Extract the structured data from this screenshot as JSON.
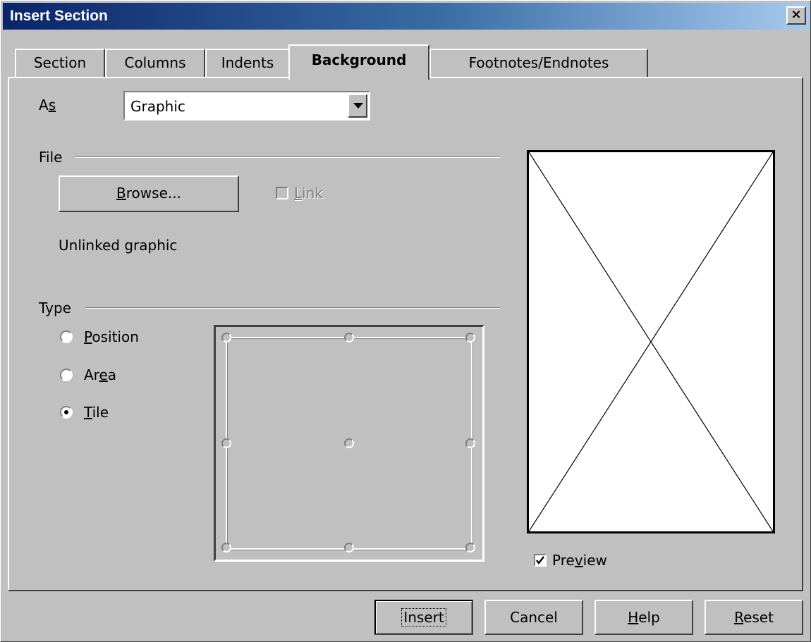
{
  "window": {
    "title": "Insert Section",
    "close_glyph": "×"
  },
  "tabs": [
    {
      "label": "Section"
    },
    {
      "label": "Columns"
    },
    {
      "label": "Indents"
    },
    {
      "label": "Background",
      "active": true
    },
    {
      "label": "Footnotes/Endnotes"
    }
  ],
  "as": {
    "label_prefix": "A",
    "label_mnemonic": "s",
    "value": "Graphic"
  },
  "file": {
    "group_label": "File",
    "browse_prefix": "",
    "browse_mnemonic": "B",
    "browse_suffix": "rowse...",
    "link_mnemonic": "L",
    "link_suffix": "ink",
    "status": "Unlinked graphic"
  },
  "type": {
    "group_label": "Type",
    "options": [
      {
        "prefix": "",
        "mnemonic": "P",
        "suffix": "osition",
        "checked": false
      },
      {
        "prefix": "Ar",
        "mnemonic": "e",
        "suffix": "a",
        "checked": false
      },
      {
        "prefix": "",
        "mnemonic": "T",
        "suffix": "ile",
        "checked": true
      }
    ]
  },
  "preview": {
    "prefix": "Pre",
    "mnemonic": "v",
    "suffix": "iew",
    "checked": true
  },
  "buttons": {
    "insert": "Insert",
    "cancel": "Cancel",
    "help_mnemonic": "H",
    "help_suffix": "elp",
    "reset_mnemonic": "R",
    "reset_suffix": "eset"
  },
  "colors": {
    "face": "#c0c0c0",
    "title_start": "#0a246a",
    "title_end": "#a6caf0"
  },
  "icons": [
    "close-icon",
    "dropdown-arrow-icon",
    "checkbox-icon",
    "radio-icon",
    "position-point-icon",
    "preview-placeholder-icon"
  ]
}
